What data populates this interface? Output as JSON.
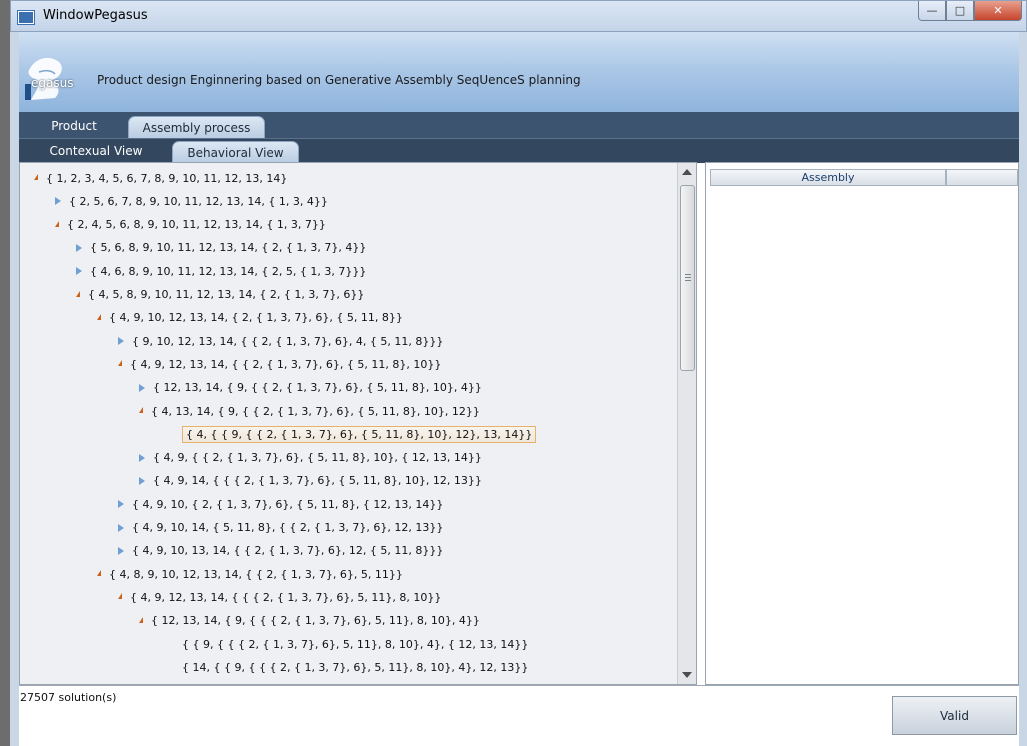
{
  "window": {
    "title": "WindowPegasus"
  },
  "banner": {
    "logo_text": "egasus",
    "subtitle": "Product design Enginnering based on Generative Assembly SeqUenceS planning"
  },
  "tabs_main": [
    {
      "label": "Product"
    },
    {
      "label": "Assembly process"
    }
  ],
  "tabs_view": [
    {
      "label": "Contexual View"
    },
    {
      "label": "Behavioral View"
    }
  ],
  "tree": [
    {
      "text": "{ 1, 2, 3, 4, 5, 6, 7, 8, 9, 10, 11, 12, 13, 14}",
      "state": "open"
    },
    {
      "text": "{ 2, 5, 6, 7, 8, 9, 10, 11, 12, 13, 14, { 1, 3, 4}}",
      "state": "closed"
    },
    {
      "text": "{ 2, 4, 5, 6, 8, 9, 10, 11, 12, 13, 14, { 1, 3, 7}}",
      "state": "open"
    },
    {
      "text": "{ 5, 6, 8, 9, 10, 11, 12, 13, 14, { 2, { 1, 3, 7}, 4}}",
      "state": "closed"
    },
    {
      "text": "{ 4, 6, 8, 9, 10, 11, 12, 13, 14, { 2, 5, { 1, 3, 7}}}",
      "state": "closed"
    },
    {
      "text": "{ 4, 5, 8, 9, 10, 11, 12, 13, 14, { 2, { 1, 3, 7}, 6}}",
      "state": "open"
    },
    {
      "text": "{ 4, 9, 10, 12, 13, 14, { 2, { 1, 3, 7}, 6}, { 5, 11, 8}}",
      "state": "open"
    },
    {
      "text": "{ 9, 10, 12, 13, 14, { { 2, { 1, 3, 7}, 6}, 4, { 5, 11, 8}}}",
      "state": "closed"
    },
    {
      "text": "{ 4, 9, 12, 13, 14, { { 2, { 1, 3, 7}, 6}, { 5, 11, 8}, 10}}",
      "state": "open"
    },
    {
      "text": "{ 12, 13, 14, { 9, { { 2, { 1, 3, 7}, 6}, { 5, 11, 8}, 10}, 4}}",
      "state": "closed"
    },
    {
      "text": "{ 4, 13, 14, { 9, { { 2, { 1, 3, 7}, 6}, { 5, 11, 8}, 10}, 12}}",
      "state": "open"
    },
    {
      "text": "{ 4, { { 9, { { 2, { 1, 3, 7}, 6}, { 5, 11, 8}, 10}, 12}, 13, 14}}",
      "state": "leaf",
      "selected": true
    },
    {
      "text": "{ 4, 9, { { 2, { 1, 3, 7}, 6}, { 5, 11, 8}, 10}, { 12, 13, 14}}",
      "state": "closed"
    },
    {
      "text": "{ 4, 9, 14, { { { 2, { 1, 3, 7}, 6}, { 5, 11, 8}, 10}, 12, 13}}",
      "state": "closed"
    },
    {
      "text": "{ 4, 9, 10, { 2, { 1, 3, 7}, 6}, { 5, 11, 8}, { 12, 13, 14}}",
      "state": "closed"
    },
    {
      "text": "{ 4, 9, 10, 14, { 5, 11, 8}, { { 2, { 1, 3, 7}, 6}, 12, 13}}",
      "state": "closed"
    },
    {
      "text": "{ 4, 9, 10, 13, 14, { { 2, { 1, 3, 7}, 6}, 12, { 5, 11, 8}}}",
      "state": "closed"
    },
    {
      "text": "{ 4, 8, 9, 10, 12, 13, 14, { { 2, { 1, 3, 7}, 6}, 5, 11}}",
      "state": "open"
    },
    {
      "text": "{ 4, 9, 12, 13, 14, { { { 2, { 1, 3, 7}, 6}, 5, 11}, 8, 10}}",
      "state": "open"
    },
    {
      "text": "{ 12, 13, 14, { 9, { { { 2, { 1, 3, 7}, 6}, 5, 11}, 8, 10}, 4}}",
      "state": "open"
    },
    {
      "text": "{ { 9, { { { 2, { 1, 3, 7}, 6}, 5, 11}, 8, 10}, 4}, { 12, 13, 14}}",
      "state": "leaf"
    },
    {
      "text": "{ 14, { { 9, { { { 2, { 1, 3, 7}, 6}, 5, 11}, 8, 10}, 4}, 12, 13}}",
      "state": "leaf"
    }
  ],
  "assembly_panel": {
    "column_header": "Assembly"
  },
  "status": {
    "solutions": "27507 solution(s)"
  },
  "valid_button": {
    "label": "Valid"
  }
}
